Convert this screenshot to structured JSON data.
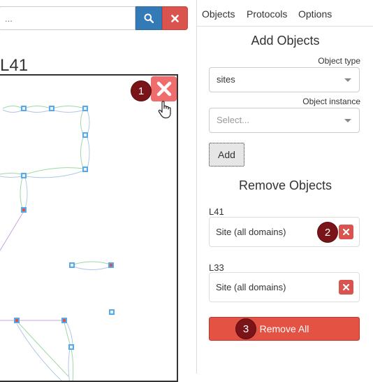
{
  "search": {
    "placeholder": "..."
  },
  "map": {
    "title": "L41"
  },
  "tabs": [
    {
      "label": "Objects"
    },
    {
      "label": "Protocols"
    },
    {
      "label": "Options"
    }
  ],
  "add_objects": {
    "title": "Add Objects",
    "type_label": "Object type",
    "type_value": "sites",
    "instance_label": "Object instance",
    "instance_placeholder": "Select...",
    "add_label": "Add"
  },
  "remove_objects": {
    "title": "Remove Objects",
    "items": [
      {
        "label": "L41",
        "value": "Site (all domains)"
      },
      {
        "label": "L33",
        "value": "Site (all domains)"
      }
    ],
    "remove_all_label": "Remove All"
  },
  "callouts": [
    "1",
    "2",
    "3"
  ],
  "icons": {
    "search": "search-icon",
    "clear": "close-icon",
    "close_map": "close-icon",
    "cursor": "hand-pointer-icon",
    "remove_item": "close-icon"
  },
  "colors": {
    "primary": "#337ab7",
    "danger": "#d9534f",
    "callout": "#7a1418",
    "node": "#5aa9e6",
    "link_green": "#8be08b",
    "link_purple": "#b58ad6"
  }
}
